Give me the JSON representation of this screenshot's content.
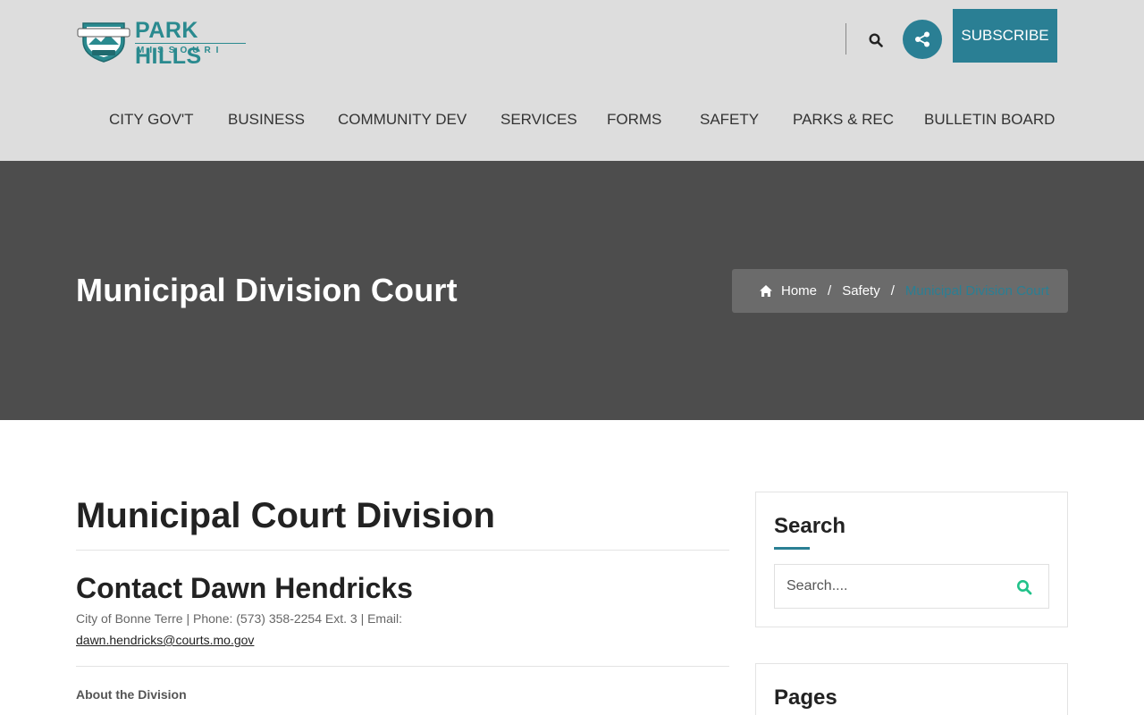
{
  "header": {
    "logo": {
      "name": "PARK HILLS",
      "subtitle": "MISSOURI"
    },
    "subscribe_label": "SUBSCRIBE",
    "accent_color": "#2a7f94",
    "background_color": "#dddddd"
  },
  "nav": {
    "items": [
      {
        "label": "CITY GOV'T"
      },
      {
        "label": "BUSINESS"
      },
      {
        "label": "COMMUNITY DEV"
      },
      {
        "label": "SERVICES"
      },
      {
        "label": "FORMS"
      },
      {
        "label": "SAFETY"
      },
      {
        "label": "PARKS & REC"
      },
      {
        "label": "BULLETIN BOARD"
      }
    ]
  },
  "hero": {
    "title": "Municipal Division Court",
    "breadcrumb": {
      "home": "Home",
      "separator": "/",
      "section": "Safety",
      "current": "Municipal Division Court"
    }
  },
  "content": {
    "title": "Municipal Court Division",
    "contact_title": "Contact Dawn Hendricks",
    "contact_info": "City of Bonne Terre | Phone: (573) 358-2254 Ext. 3 | Email:",
    "contact_email": "dawn.hendricks@courts.mo.gov",
    "about_title": "About the Division"
  },
  "sidebar": {
    "search": {
      "title": "Search",
      "placeholder": "Search...."
    },
    "pages": {
      "title": "Pages"
    }
  },
  "icons": {
    "search": "search-icon",
    "share": "share-icon",
    "home": "home-icon"
  }
}
